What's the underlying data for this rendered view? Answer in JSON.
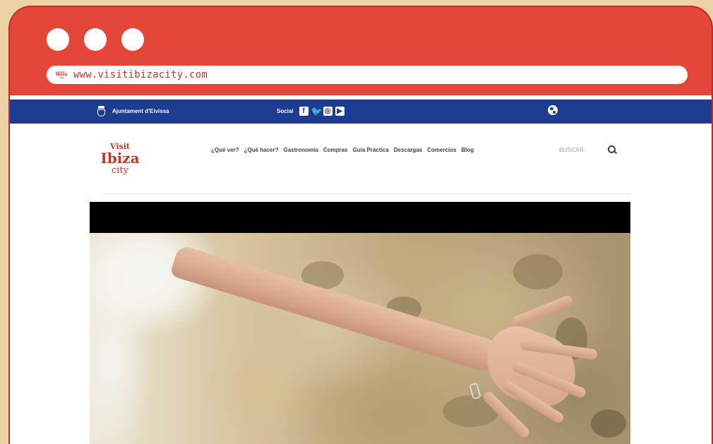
{
  "browser": {
    "url": "www.visitibizacity.com",
    "favicon": {
      "line1": "Visit",
      "line2": "Ibiza",
      "line3": "city"
    },
    "colors": {
      "frame": "#e5463a",
      "background": "#ecd3a6",
      "url_text": "#c0392b"
    }
  },
  "site": {
    "topbar": {
      "ayuntamiento_label": "Ajuntament d'Eivissa",
      "social_label": "Social",
      "social_icons": [
        "facebook-icon",
        "twitter-icon",
        "instagram-icon",
        "youtube-icon"
      ],
      "language_icon": "globe-icon",
      "color": "#1d3c8f"
    },
    "logo": {
      "line1": "Visit",
      "line2": "Ibiza",
      "line3": "city",
      "color": "#c0392b"
    },
    "nav": {
      "items": [
        {
          "label": "¿Qué ver?"
        },
        {
          "label": "¿Qué hacer?"
        },
        {
          "label": "Gastronomía"
        },
        {
          "label": "Compras"
        },
        {
          "label": "Guía Práctica"
        },
        {
          "label": "Descargas"
        },
        {
          "label": "Comercios"
        },
        {
          "label": "Blog"
        }
      ]
    },
    "search": {
      "label": "BUSCAR",
      "icon": "search-icon"
    },
    "hero": {
      "image": "hand-touching-stone-wall-photo"
    }
  }
}
